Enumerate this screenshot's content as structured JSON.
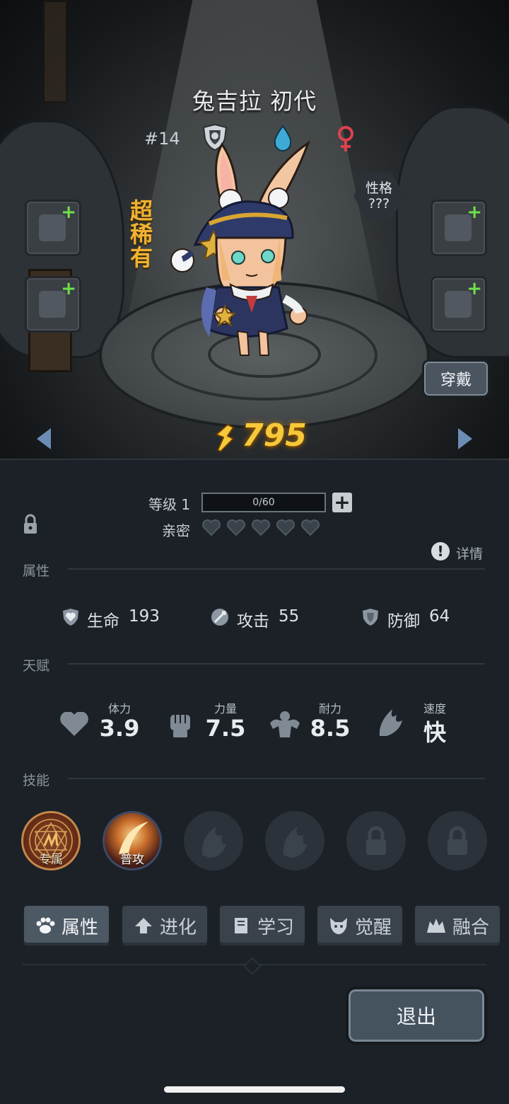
{
  "hero": {
    "name": "兔吉拉 初代",
    "number": "#14",
    "rarity": "超稀有",
    "personality": {
      "label": "性格",
      "value": "???"
    },
    "wear_label": "穿戴",
    "power": "795"
  },
  "level": {
    "label": "等级 1",
    "progress_text": "0/60",
    "progress": 0
  },
  "intimacy": {
    "label": "亲密",
    "hearts_filled": 0,
    "hearts_total": 5
  },
  "details_label": "详情",
  "sections": {
    "attributes": "属性",
    "talents": "天赋",
    "skills": "技能"
  },
  "attributes": [
    {
      "icon": "heart-shield-icon",
      "label": "生命",
      "value": "193"
    },
    {
      "icon": "sword-icon",
      "label": "攻击",
      "value": "55"
    },
    {
      "icon": "shield-icon",
      "label": "防御",
      "value": "64"
    }
  ],
  "talents": [
    {
      "icon": "heart-icon",
      "label": "体力",
      "value": "3.9"
    },
    {
      "icon": "fist-icon",
      "label": "力量",
      "value": "7.5"
    },
    {
      "icon": "muscle-icon",
      "label": "耐力",
      "value": "8.5"
    },
    {
      "icon": "wing-icon",
      "label": "速度",
      "value": "快"
    }
  ],
  "skills": [
    {
      "label": "专属",
      "state": "active"
    },
    {
      "label": "普攻",
      "state": "active"
    },
    {
      "label": "",
      "state": "empty"
    },
    {
      "label": "",
      "state": "empty"
    },
    {
      "label": "",
      "state": "locked"
    },
    {
      "label": "",
      "state": "locked"
    }
  ],
  "tabs": [
    {
      "label": "属性",
      "icon": "paw-icon",
      "active": true
    },
    {
      "label": "进化",
      "icon": "up-arrow-icon",
      "active": false
    },
    {
      "label": "学习",
      "icon": "book-icon",
      "active": false
    },
    {
      "label": "觉醒",
      "icon": "beast-icon",
      "active": false
    },
    {
      "label": "融合",
      "icon": "fusion-icon",
      "active": false
    }
  ],
  "exit_label": "退出",
  "colors": {
    "rarity": "#f2b230",
    "power": "#f6c93a",
    "plus_green": "#6fe04a",
    "panel_bg": "#1b2127"
  }
}
